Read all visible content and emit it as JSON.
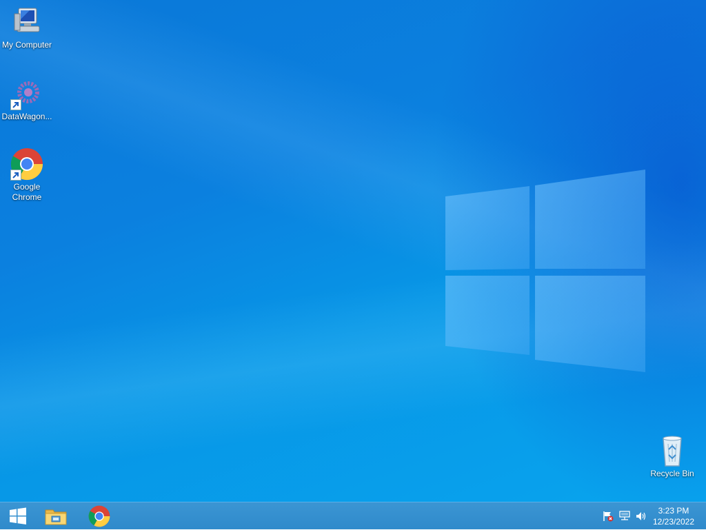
{
  "desktop": {
    "icons": [
      {
        "label": "My Computer",
        "icon": "computer-icon"
      },
      {
        "label": "DataWagon...",
        "icon": "datawagon-icon"
      },
      {
        "label_line1": "Google",
        "label_line2": "Chrome",
        "icon": "chrome-icon"
      },
      {
        "label": "Recycle Bin",
        "icon": "recycle-bin-icon"
      }
    ],
    "wallpaper": "windows-10-hero-blue"
  },
  "taskbar": {
    "start_icon": "windows-start-icon",
    "pinned": [
      "file-explorer-icon",
      "chrome-icon"
    ],
    "tray": [
      "action-center-flag-icon",
      "network-icon",
      "volume-icon"
    ],
    "time": "3:23 PM",
    "date": "12/23/2022"
  },
  "colors": {
    "taskbar": "#2f8acb",
    "wallpaper_base": "#0b80df"
  }
}
